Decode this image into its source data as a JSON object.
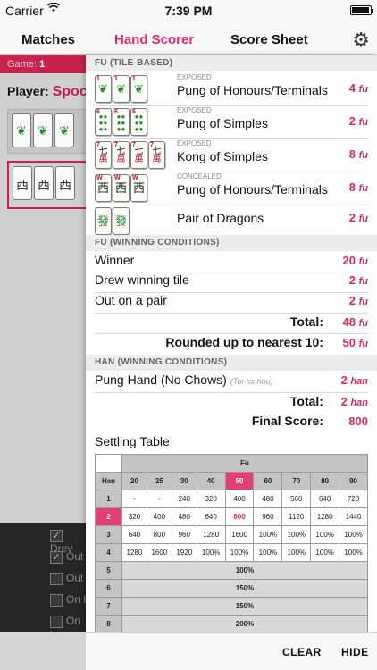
{
  "status_bar": {
    "carrier": "Carrier",
    "time": "7:39 PM"
  },
  "nav": {
    "tabs": [
      "Matches",
      "Hand Scorer",
      "Score Sheet"
    ],
    "active_tab": "Hand Scorer"
  },
  "background": {
    "game_label": "Game:",
    "game_number": "1",
    "player_label": "Player:",
    "player_name": "Spoc",
    "checkbox_labels": [
      "Drev",
      "Out",
      "Out",
      "On l",
      "On t"
    ]
  },
  "fu_tile": {
    "header": "FU (TILE-BASED)",
    "rows": [
      {
        "eyebrow": "EXPOSED",
        "title": "Pung of Honours/Terminals",
        "value": "4",
        "unit": "fu"
      },
      {
        "eyebrow": "EXPOSED",
        "title": "Pung of Simples",
        "value": "2",
        "unit": "fu"
      },
      {
        "eyebrow": "EXPOSED",
        "title": "Kong of Simples",
        "value": "8",
        "unit": "fu"
      },
      {
        "eyebrow": "CONCEALED",
        "title": "Pung of Honours/Terminals",
        "value": "8",
        "unit": "fu"
      },
      {
        "eyebrow": "",
        "title": "Pair of Dragons",
        "value": "2",
        "unit": "fu"
      }
    ]
  },
  "fu_win": {
    "header": "FU (WINNING CONDITIONS)",
    "rows": [
      {
        "title": "Winner",
        "value": "20",
        "unit": "fu"
      },
      {
        "title": "Drew winning tile",
        "value": "2",
        "unit": "fu"
      },
      {
        "title": "Out on a pair",
        "value": "2",
        "unit": "fu"
      }
    ],
    "total_label": "Total:",
    "total_value": "48",
    "total_unit": "fu",
    "rounded_label": "Rounded up to nearest 10:",
    "rounded_value": "50",
    "rounded_unit": "fu"
  },
  "han_win": {
    "header": "HAN (WINNING CONDITIONS)",
    "row": {
      "title": "Pung Hand (No Chows)",
      "alt": "(Toi-toi hou)",
      "value": "2",
      "unit": "han"
    },
    "total_label": "Total:",
    "total_value": "2",
    "total_unit": "han",
    "final_label": "Final Score:",
    "final_value": "800"
  },
  "settling": {
    "title": "Settling Table",
    "fu_header": "Fu",
    "han_header": "Han",
    "fu_values": [
      "20",
      "25",
      "30",
      "40",
      "50",
      "60",
      "70",
      "80",
      "90"
    ],
    "rows": [
      {
        "han": "1",
        "cells": [
          "-",
          "-",
          "240",
          "320",
          "400",
          "480",
          "560",
          "640",
          "720"
        ]
      },
      {
        "han": "2",
        "cells": [
          "320",
          "400",
          "480",
          "640",
          "800",
          "960",
          "1120",
          "1280",
          "1440"
        ]
      },
      {
        "han": "3",
        "cells": [
          "640",
          "800",
          "960",
          "1280",
          "1600",
          "100%",
          "100%",
          "100%",
          "100%"
        ]
      },
      {
        "han": "4",
        "cells": [
          "1280",
          "1600",
          "1920",
          "100%",
          "100%",
          "100%",
          "100%",
          "100%",
          "100%"
        ]
      }
    ],
    "wide_rows": [
      {
        "han": "5",
        "value": "100%"
      },
      {
        "han": "6",
        "value": "150%"
      },
      {
        "han": "7",
        "value": "150%"
      },
      {
        "han": "8",
        "value": "200%"
      }
    ],
    "highlight_fu": "50",
    "highlight_han": "2"
  },
  "toolbar": {
    "clear_label": "CLEAR",
    "hide_label": "HIDE"
  },
  "colors": {
    "accent": "#d4295f",
    "highlight": "#e23f79",
    "game_bar": "#c6244f"
  }
}
